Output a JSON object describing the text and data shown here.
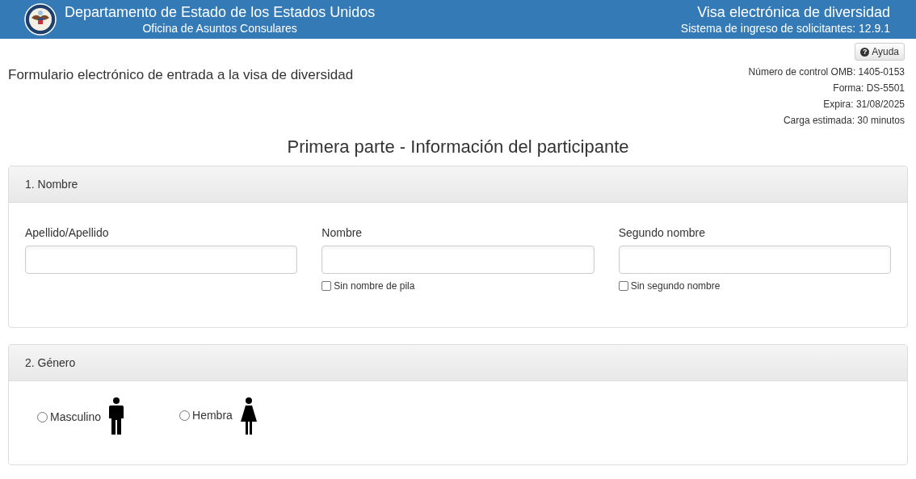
{
  "header": {
    "title": "Departamento de Estado de los Estados Unidos",
    "subtitle": "Oficina de Asuntos Consulares",
    "app_title": "Visa electrónica de diversidad",
    "app_version": "Sistema de ingreso de solicitantes: 12.9.1"
  },
  "help_button": {
    "icon": "?",
    "label": "Ayuda"
  },
  "form_title": "Formulario electrónico de entrada a la visa de diversidad",
  "meta": [
    "Número de control OMB: 1405-0153",
    "Forma: DS-5501",
    "Expira: 31/08/2025",
    "Carga estimada: 30 minutos"
  ],
  "page_heading": "Primera parte - Información del participante",
  "name_panel": {
    "title": "1. Nombre",
    "fields": [
      {
        "label": "Apellido/Apellido"
      },
      {
        "label": "Nombre",
        "checkbox": {
          "label": "Sin nombre de pila",
          "checked": false
        }
      },
      {
        "label": "Segundo nombre",
        "checkbox": {
          "label": "Sin segundo nombre",
          "checked": false
        }
      }
    ]
  },
  "gender_panel": {
    "title": "2. Género",
    "options": [
      {
        "label": "Masculino",
        "kind": "male",
        "selected": false
      },
      {
        "label": "Hembra",
        "kind": "female",
        "selected": false
      }
    ]
  }
}
